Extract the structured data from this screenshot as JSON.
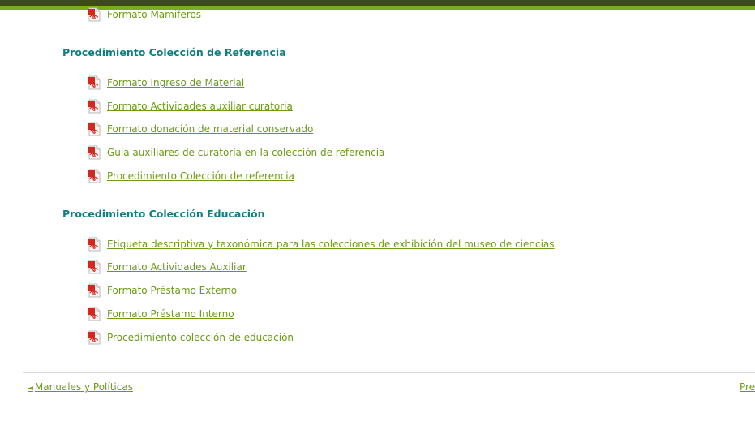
{
  "sections": [
    {
      "heading": "",
      "items": [
        {
          "label": "Formato Mamiferos",
          "icon": "pdf-icon"
        }
      ]
    },
    {
      "heading": "Procedimiento Colección de Referencia",
      "items": [
        {
          "label": "Formato Ingreso de Material",
          "icon": "pdf-icon"
        },
        {
          "label": "Formato Actividades auxiliar curatoria",
          "icon": "pdf-icon"
        },
        {
          "label": "Formato donación de material conservado",
          "icon": "pdf-icon"
        },
        {
          "label": "Guía auxiliares de curatoría en la colección de referencia",
          "icon": "pdf-icon"
        },
        {
          "label": "Procedimiento Colección de referencia",
          "icon": "pdf-icon"
        }
      ]
    },
    {
      "heading": "Procedimiento Colección Educación",
      "items": [
        {
          "label": "Etiqueta descriptiva y taxonómica para las colecciones de exhibición del museo de ciencias",
          "icon": "pdf-icon"
        },
        {
          "label": "Formato Actividades Auxiliar",
          "icon": "pdf-icon"
        },
        {
          "label": "Formato Préstamo Externo",
          "icon": "pdf-icon"
        },
        {
          "label": "Formato Préstamo Interno",
          "icon": "pdf-icon"
        },
        {
          "label": "Procedimiento colección de educación",
          "icon": "pdf-icon"
        }
      ]
    }
  ],
  "pager": {
    "prev_arrow": "◄",
    "prev_label": "Manuales y Políticas",
    "next_label": "Pre"
  },
  "colors": {
    "heading": "#0f7f80",
    "link": "#6b9a16",
    "top_bar": "#3d4a1a",
    "top_bar_accent": "#7bab1f",
    "pdf_red": "#d7261e"
  }
}
